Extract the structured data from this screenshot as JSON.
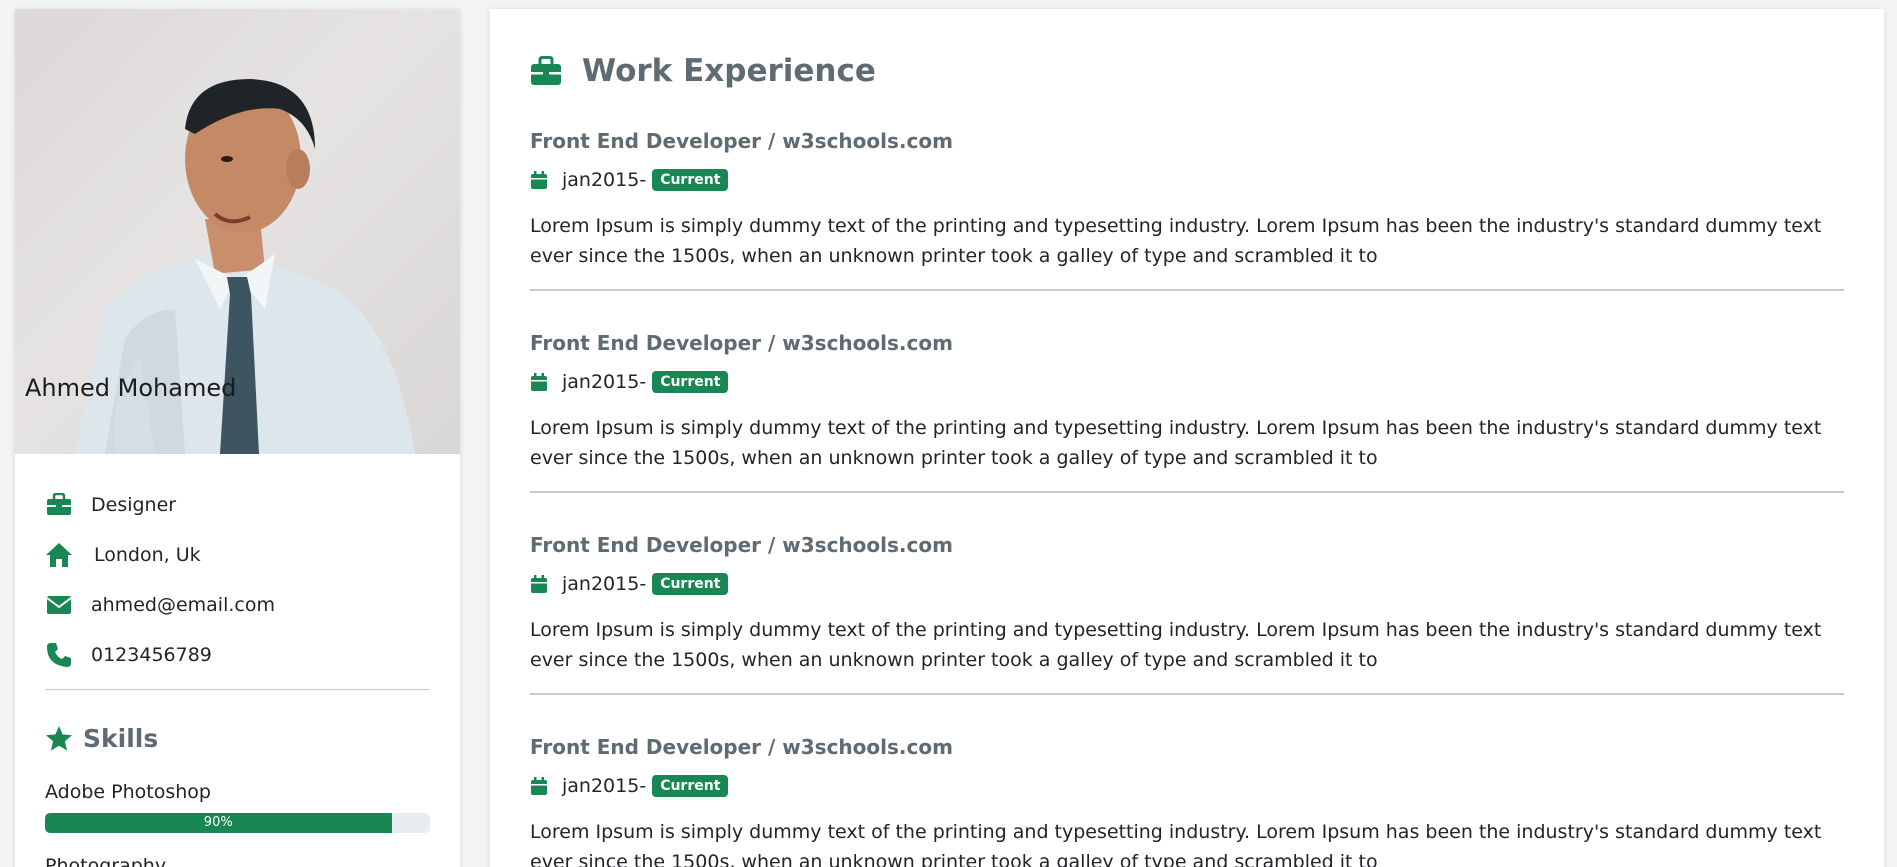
{
  "colors": {
    "accent": "#198754",
    "heading": "#5f6b73",
    "text": "#212529",
    "divider": "#c9c9c9"
  },
  "profile": {
    "name": "Ahmed Mohamed",
    "photo_icon": "profile-photo",
    "info": [
      {
        "icon": "briefcase-icon",
        "text": "Designer"
      },
      {
        "icon": "home-icon",
        "text": "London, Uk"
      },
      {
        "icon": "envelope-icon",
        "text": "ahmed@email.com"
      },
      {
        "icon": "phone-icon",
        "text": "0123456789"
      }
    ]
  },
  "skills": {
    "title": "Skills",
    "icon": "star-icon",
    "items": [
      {
        "name": "Adobe Photoshop",
        "percent": 90,
        "percent_label": "90%"
      },
      {
        "name": "Photography"
      }
    ]
  },
  "work": {
    "title": "Work Experience",
    "icon": "briefcase-icon",
    "jobs": [
      {
        "title": "Front End Developer / w3schools.com",
        "date": "jan2015-",
        "badge": "Current",
        "description": "Lorem Ipsum is simply dummy text of the printing and typesetting industry. Lorem Ipsum has been the industry's standard dummy text ever since the 1500s, when an unknown printer took a galley of type and scrambled it to"
      },
      {
        "title": "Front End Developer / w3schools.com",
        "date": "jan2015-",
        "badge": "Current",
        "description": "Lorem Ipsum is simply dummy text of the printing and typesetting industry. Lorem Ipsum has been the industry's standard dummy text ever since the 1500s, when an unknown printer took a galley of type and scrambled it to"
      },
      {
        "title": "Front End Developer / w3schools.com",
        "date": "jan2015-",
        "badge": "Current",
        "description": "Lorem Ipsum is simply dummy text of the printing and typesetting industry. Lorem Ipsum has been the industry's standard dummy text ever since the 1500s, when an unknown printer took a galley of type and scrambled it to"
      },
      {
        "title": "Front End Developer / w3schools.com",
        "date": "jan2015-",
        "badge": "Current",
        "description": "Lorem Ipsum is simply dummy text of the printing and typesetting industry. Lorem Ipsum has been the industry's standard dummy text ever since the 1500s, when an unknown printer took a galley of type and scrambled it to"
      }
    ]
  }
}
